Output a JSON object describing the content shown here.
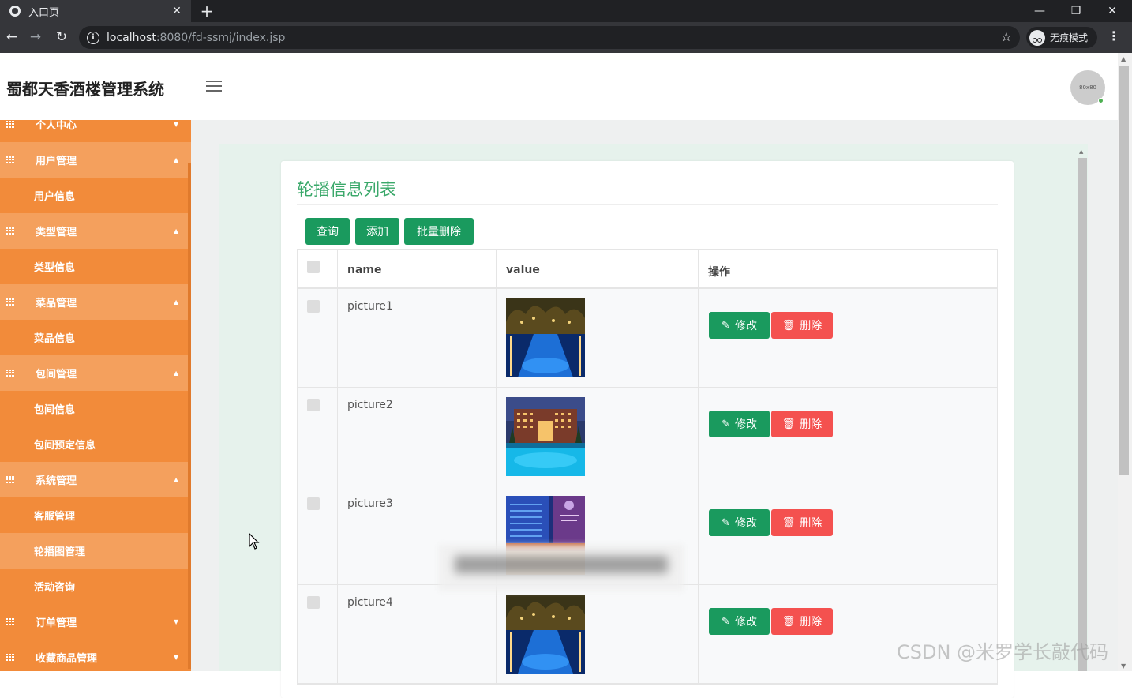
{
  "browser": {
    "tab_title": "入口页",
    "url_host": "localhost",
    "url_path": ":8080/fd-ssmj/index.jsp",
    "incognito_label": "无痕模式"
  },
  "header": {
    "brand": "蜀都天香酒楼管理系统",
    "avatar_text": "80x80"
  },
  "sidebar": {
    "items": [
      {
        "type": "group",
        "label": "个人中心",
        "open": false
      },
      {
        "type": "group",
        "label": "用户管理",
        "open": true
      },
      {
        "type": "sub",
        "label": "用户信息"
      },
      {
        "type": "group",
        "label": "类型管理",
        "open": true
      },
      {
        "type": "sub",
        "label": "类型信息"
      },
      {
        "type": "group",
        "label": "菜品管理",
        "open": true
      },
      {
        "type": "sub",
        "label": "菜品信息"
      },
      {
        "type": "group",
        "label": "包间管理",
        "open": true
      },
      {
        "type": "sub",
        "label": "包间信息"
      },
      {
        "type": "sub",
        "label": "包间预定信息"
      },
      {
        "type": "group",
        "label": "系统管理",
        "open": true
      },
      {
        "type": "sub",
        "label": "客服管理"
      },
      {
        "type": "sub",
        "label": "轮播图管理",
        "active": true
      },
      {
        "type": "sub",
        "label": "活动咨询"
      },
      {
        "type": "group",
        "label": "订单管理",
        "open": false
      },
      {
        "type": "group",
        "label": "收藏商品管理",
        "open": false
      }
    ]
  },
  "main": {
    "title": "轮播信息列表",
    "buttons": {
      "query": "查询",
      "add": "添加",
      "batch_delete": "批量删除"
    },
    "table": {
      "headers": {
        "name": "name",
        "value": "value",
        "ops": "操作"
      },
      "rows": [
        {
          "name": "picture1",
          "image": "night-pool-resort"
        },
        {
          "name": "picture2",
          "image": "hotel-pool-dusk"
        },
        {
          "name": "picture3",
          "image": "hotel-tower-night"
        },
        {
          "name": "picture4",
          "image": "night-pool-resort"
        }
      ],
      "edit_label": "修改",
      "delete_label": "删除"
    }
  },
  "watermark": "CSDN @米罗学长敲代码",
  "colors": {
    "sidebar": "#f28b3a",
    "sidebar_active": "#f4a05d",
    "primary": "#1a9a5e",
    "danger": "#f4514f",
    "title": "#3aa86a"
  }
}
